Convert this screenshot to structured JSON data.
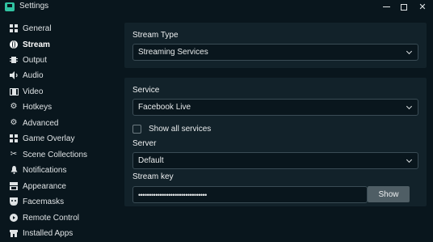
{
  "window": {
    "title": "Settings",
    "minimize_label": "",
    "close_glyph": "✕"
  },
  "sidebar": {
    "items": [
      {
        "label": "General",
        "icon": "grid-icon",
        "active": false
      },
      {
        "label": "Stream",
        "icon": "globe-icon",
        "active": true
      },
      {
        "label": "Output",
        "icon": "output-icon",
        "active": false
      },
      {
        "label": "Audio",
        "icon": "speaker-icon",
        "active": false
      },
      {
        "label": "Video",
        "icon": "film-icon",
        "active": false
      },
      {
        "label": "Hotkeys",
        "icon": "gear-icon",
        "active": false
      },
      {
        "label": "Advanced",
        "icon": "gears-icon",
        "active": false
      },
      {
        "label": "Game Overlay",
        "icon": "overlay-icon",
        "active": false
      },
      {
        "label": "Scene Collections",
        "icon": "tools-icon",
        "active": false
      },
      {
        "label": "Notifications",
        "icon": "bell-icon",
        "active": false
      },
      {
        "label": "Appearance",
        "icon": "layers-icon",
        "active": false
      },
      {
        "label": "Facemasks",
        "icon": "mask-icon",
        "active": false
      },
      {
        "label": "Remote Control",
        "icon": "remote-icon",
        "active": false
      },
      {
        "label": "Installed Apps",
        "icon": "store-icon",
        "active": false
      }
    ]
  },
  "stream_type": {
    "label": "Stream Type",
    "value": "Streaming Services"
  },
  "service": {
    "label": "Service",
    "value": "Facebook Live",
    "show_all_label": "Show all services",
    "show_all_checked": false
  },
  "server": {
    "label": "Server",
    "value": "Default"
  },
  "stream_key": {
    "label": "Stream key",
    "value": "••••••••••••••••••••••••••••••••",
    "show_button": "Show"
  },
  "colors": {
    "background": "#09161d",
    "panel": "#12222a",
    "accent": "#31c3a2"
  }
}
